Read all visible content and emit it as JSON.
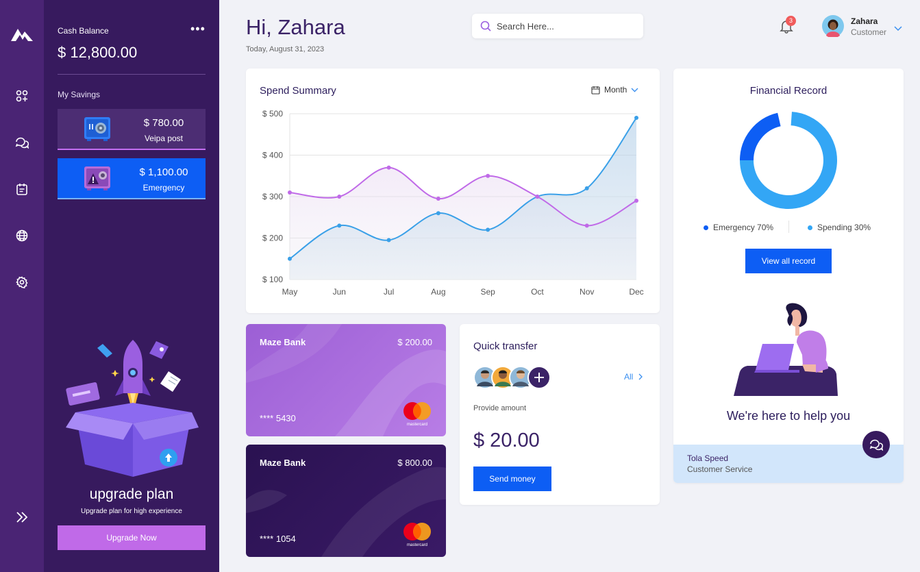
{
  "sidebar": {
    "nav_icons": [
      "logo-icon",
      "apps-icon",
      "chat-icon",
      "calendar-icon",
      "globe-icon",
      "settings-icon",
      "expand-icon"
    ]
  },
  "panel": {
    "cash_label": "Cash Balance",
    "cash_value": "$ 12,800.00",
    "savings_label": "My Savings",
    "savings": [
      {
        "amount": "$ 780.00",
        "name": "Veipa post"
      },
      {
        "amount": "$ 1,100.00",
        "name": "Emergency"
      }
    ],
    "upgrade_title": "upgrade plan",
    "upgrade_subtitle": "Upgrade plan for high experience",
    "upgrade_button": "Upgrade Now"
  },
  "header": {
    "greeting": "Hi, Zahara",
    "date": "Today, August 31, 2023",
    "search_placeholder": "Search Here...",
    "notification_count": "3",
    "user_name": "Zahara",
    "user_role": "Customer"
  },
  "spend": {
    "title": "Spend Summary",
    "period": "Month"
  },
  "chart_data": {
    "type": "line",
    "title": "Spend Summary",
    "categories": [
      "May",
      "Jun",
      "Jul",
      "Aug",
      "Sep",
      "Oct",
      "Nov",
      "Dec"
    ],
    "y_ticks": [
      "$ 100",
      "$ 200",
      "$ 300",
      "$ 400",
      "$ 500"
    ],
    "ylim": [
      100,
      500
    ],
    "grid": true,
    "series": [
      {
        "color": "#3aa0e8",
        "values": [
          150,
          230,
          195,
          260,
          220,
          300,
          320,
          490
        ]
      },
      {
        "color": "#c06ae8",
        "values": [
          310,
          300,
          370,
          295,
          350,
          300,
          230,
          290
        ]
      }
    ]
  },
  "financial": {
    "title": "Financial Record",
    "legend": [
      {
        "label": "Emergency 70%",
        "color": "#0d5ef4"
      },
      {
        "label": "Spending 30%",
        "color": "#33a6f5"
      }
    ],
    "button": "View all record",
    "help_title": "We're here to help you",
    "service_name": "Tola Speed",
    "service_role": "Customer Service"
  },
  "cards": [
    {
      "bank": "Maze Bank",
      "amount": "$ 200.00",
      "number": "**** 5430",
      "brand": "mastercard"
    },
    {
      "bank": "Maze Bank",
      "amount": "$ 800.00",
      "number": "**** 1054",
      "brand": "mastercard"
    }
  ],
  "quick_transfer": {
    "title": "Quick transfer",
    "all_label": "All",
    "provide_label": "Provide amount",
    "amount": "$ 20.00",
    "button": "Send money"
  }
}
